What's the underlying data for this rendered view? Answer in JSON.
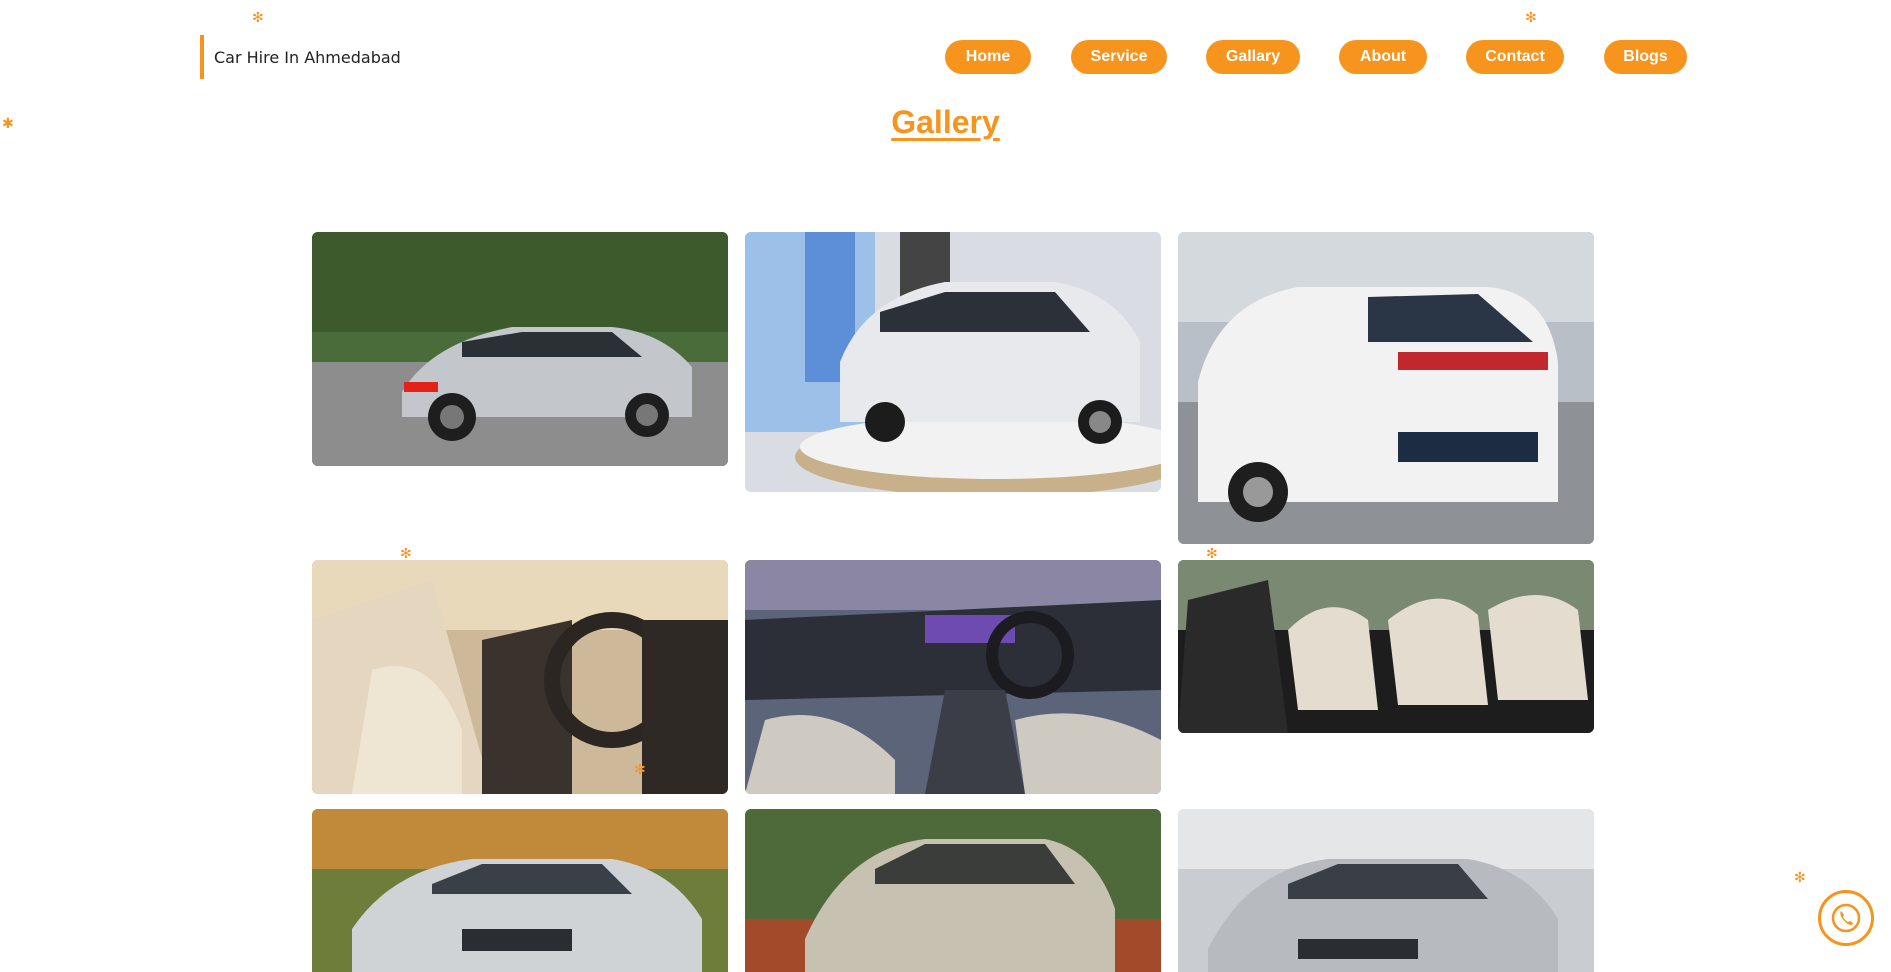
{
  "brand": {
    "text": "Car Hire In Ahmedabad"
  },
  "nav": {
    "items": [
      {
        "label": "Home"
      },
      {
        "label": "Service"
      },
      {
        "label": "Gallary"
      },
      {
        "label": "About"
      },
      {
        "label": "Contact"
      },
      {
        "label": "Blogs"
      }
    ]
  },
  "page": {
    "title": "Gallery"
  },
  "gallery": {
    "images": [
      {
        "subject": "silver Kia Carens on road",
        "icon": "car-photo"
      },
      {
        "subject": "white Kia Carens on showroom stage",
        "icon": "car-photo"
      },
      {
        "subject": "white Kia Carens rear view",
        "icon": "car-photo"
      },
      {
        "subject": "front seats interior",
        "icon": "interior-photo"
      },
      {
        "subject": "dashboard interior",
        "icon": "interior-photo"
      },
      {
        "subject": "three-row seating interior",
        "icon": "interior-photo"
      },
      {
        "subject": "silver Maruti Dzire front",
        "icon": "car-photo"
      },
      {
        "subject": "silver Dzire on red soil",
        "icon": "car-photo"
      },
      {
        "subject": "silver Dzire side front",
        "icon": "car-photo"
      }
    ]
  },
  "colors": {
    "accent": "#f7941d",
    "text": "#222222",
    "background": "#ffffff"
  },
  "floating": {
    "icon": "whatsapp-phone-icon"
  }
}
